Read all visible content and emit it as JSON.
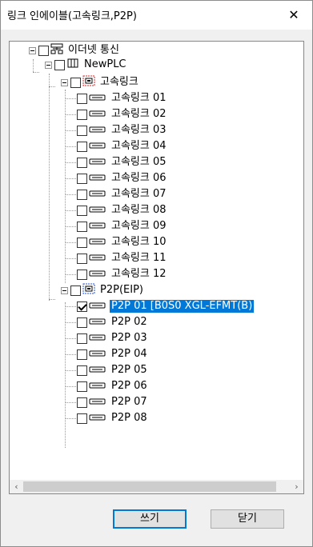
{
  "window": {
    "title": "링크 인에이블(고속링크,P2P)",
    "close_symbol": "✕"
  },
  "tree": {
    "root": {
      "label": "이더넷 통신",
      "icon": "network-icon"
    },
    "plc": {
      "label": "NewPLC",
      "icon": "plc-icon"
    },
    "highspeed_group": {
      "label": "고속링크",
      "icon": "link-group-icon",
      "items": [
        "고속링크 01",
        "고속링크 02",
        "고속링크 03",
        "고속링크 04",
        "고속링크 05",
        "고속링크 06",
        "고속링크 07",
        "고속링크 08",
        "고속링크 09",
        "고속링크 10",
        "고속링크 11",
        "고속링크 12"
      ]
    },
    "p2p_group": {
      "label": "P2P(EIP)",
      "icon": "p2p-group-icon",
      "items": [
        {
          "label": "P2P 01 [B0S0 XGL-EFMT(B)",
          "checked": true,
          "selected": true
        },
        {
          "label": "P2P 02",
          "checked": false,
          "selected": false
        },
        {
          "label": "P2P 03",
          "checked": false,
          "selected": false
        },
        {
          "label": "P2P 04",
          "checked": false,
          "selected": false
        },
        {
          "label": "P2P 05",
          "checked": false,
          "selected": false
        },
        {
          "label": "P2P 06",
          "checked": false,
          "selected": false
        },
        {
          "label": "P2P 07",
          "checked": false,
          "selected": false
        },
        {
          "label": "P2P 08",
          "checked": false,
          "selected": false
        }
      ]
    }
  },
  "scrollbar": {
    "left_arrow": "‹",
    "right_arrow": "›"
  },
  "buttons": {
    "write": "쓰기",
    "close": "닫기"
  },
  "colors": {
    "selection": "#0078d7",
    "group_icon_red": "#e02020",
    "group_icon_blue": "#2050e0"
  }
}
